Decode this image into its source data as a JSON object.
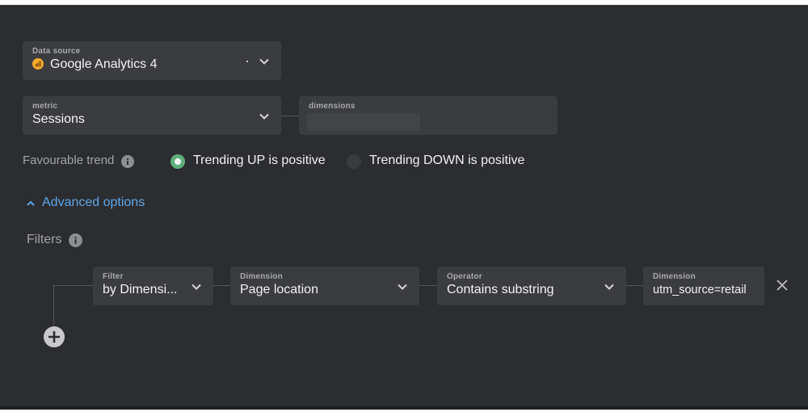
{
  "data_source": {
    "label": "Data source",
    "value": "Google Analytics 4",
    "icon": "google-analytics-icon",
    "icon_color": "#f4a82e"
  },
  "metric": {
    "label": "metric",
    "value": "Sessions"
  },
  "dimensions": {
    "label": "dimensions",
    "value": ""
  },
  "favourable_trend": {
    "label": "Favourable trend",
    "options": [
      {
        "label": "Trending UP is positive",
        "selected": true
      },
      {
        "label": "Trending DOWN is positive",
        "selected": false
      }
    ]
  },
  "advanced_options": {
    "label": "Advanced options",
    "expanded": true,
    "color": "#5ea6e8"
  },
  "filters": {
    "label": "Filters",
    "row": {
      "filter": {
        "label": "Filter",
        "value": "by Dimensi..."
      },
      "dimension": {
        "label": "Dimension",
        "value": "Page location"
      },
      "operator": {
        "label": "Operator",
        "value": "Contains substring"
      },
      "dimension_value": {
        "label": "Dimension",
        "value": "utm_source=retail"
      }
    }
  },
  "colors": {
    "panel": "#2c2d31",
    "field": "#3b3c40",
    "radio_selected": "#5fae7c"
  }
}
